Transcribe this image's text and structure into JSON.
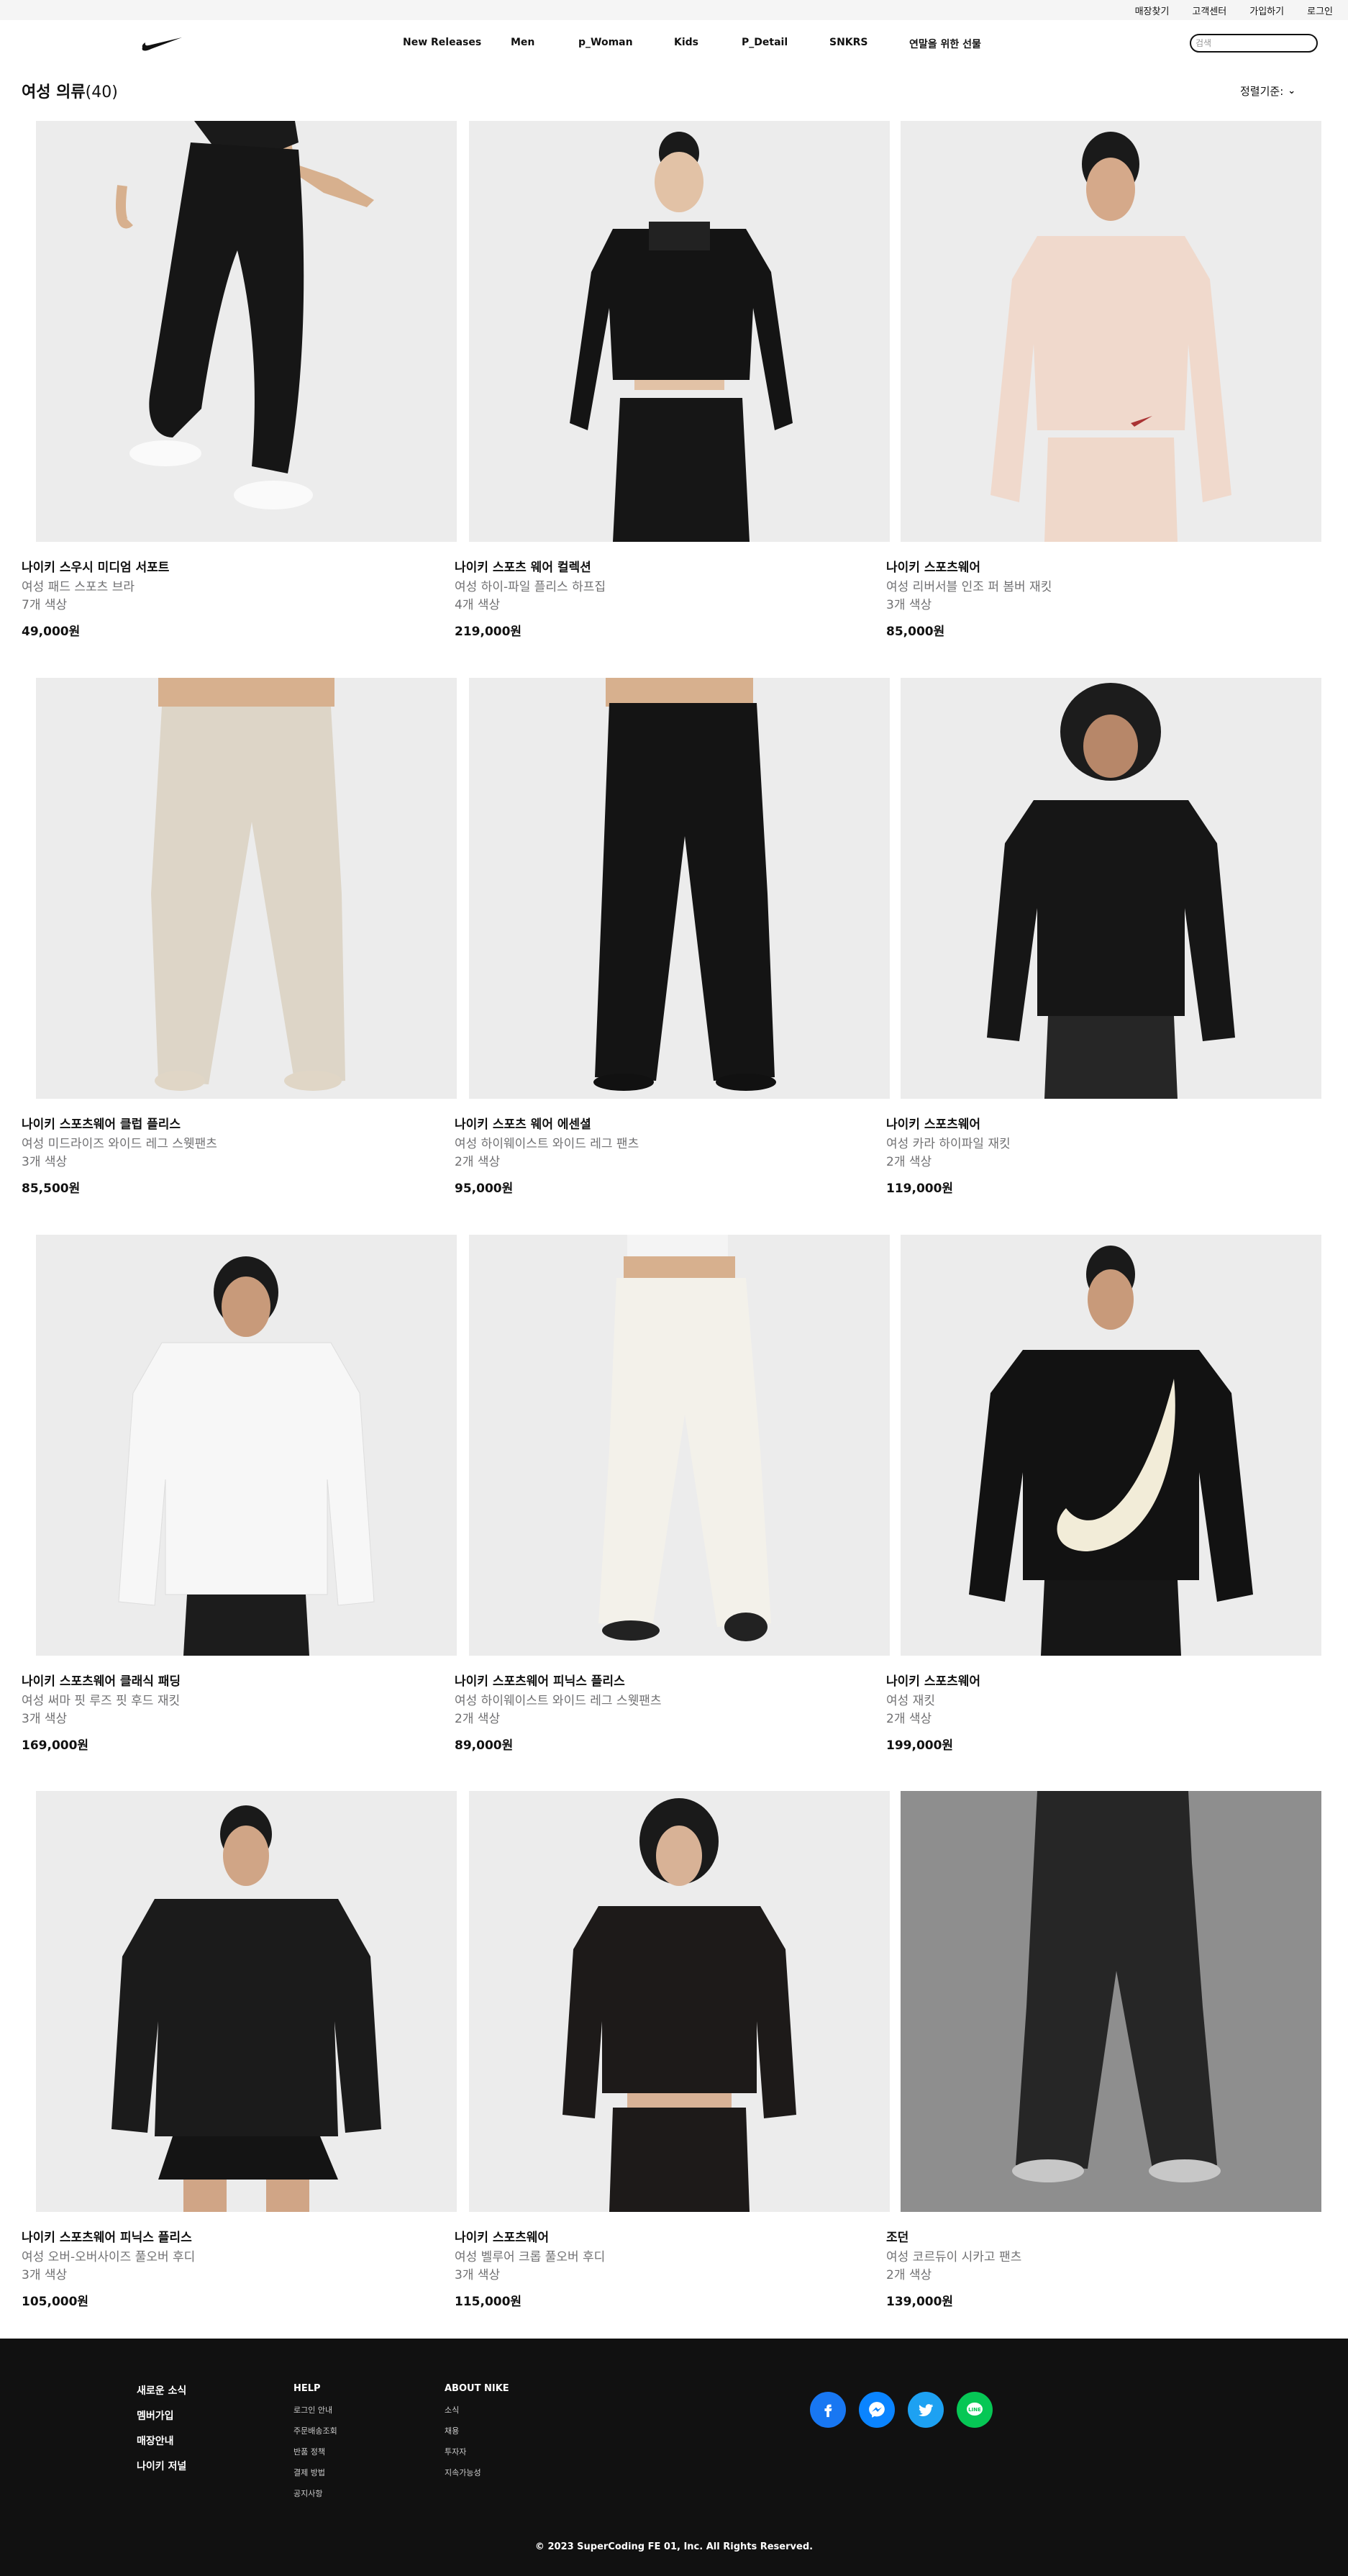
{
  "utility": [
    "매장찾기",
    "고객센터",
    "가입하기",
    "로그인"
  ],
  "nav": {
    "links": [
      "New Releases",
      "Men",
      "p_Woman",
      "Kids",
      "P_Detail",
      "SNKRS",
      "연말을 위한 선물"
    ],
    "search_placeholder": "검색"
  },
  "heading": {
    "title": "여성 의류",
    "count": "(40)"
  },
  "sort": {
    "label": "정렬기준:"
  },
  "products": [
    {
      "name": "나이키 스우시 미디엄 서포트",
      "sub": "여성 패드 스포츠 브라",
      "colors": "7개 색상",
      "price": "49,000원"
    },
    {
      "name": "나이키 스포츠 웨어 컬렉션",
      "sub": "여성 하이-파일 플리스 하프집",
      "colors": "4개 색상",
      "price": "219,000원"
    },
    {
      "name": "나이키 스포츠웨어",
      "sub": "여성 리버서블 인조 퍼 봄버 재킷",
      "colors": "3개 색상",
      "price": "85,000원"
    },
    {
      "name": "나이키 스포츠웨어 클럽 플리스",
      "sub": "여성 미드라이즈 와이드 레그 스웻팬츠",
      "colors": "3개 색상",
      "price": "85,500원"
    },
    {
      "name": "나이키 스포츠 웨어 에센셜",
      "sub": "여성 하이웨이스트 와이드 레그 팬츠",
      "colors": "2개 색상",
      "price": "95,000원"
    },
    {
      "name": "나이키 스포츠웨어",
      "sub": "여성 카라 하이파일 재킷",
      "colors": "2개 색상",
      "price": "119,000원"
    },
    {
      "name": "나이키 스포츠웨어 클래식 패딩",
      "sub": "여성 써마 핏 루즈 핏 후드 재킷",
      "colors": "3개 색상",
      "price": "169,000원"
    },
    {
      "name": "나이키 스포츠웨어 피닉스 플리스",
      "sub": "여성 하이웨이스트 와이드 레그 스웻팬츠",
      "colors": "2개 색상",
      "price": "89,000원"
    },
    {
      "name": "나이키 스포츠웨어",
      "sub": "여성 재킷",
      "colors": "2개 색상",
      "price": "199,000원"
    },
    {
      "name": "나이키 스포츠웨어 피닉스 플리스",
      "sub": "여성 오버-오버사이즈 풀오버 후디",
      "colors": "3개 색상",
      "price": "105,000원"
    },
    {
      "name": "나이키 스포츠웨어",
      "sub": "여성 벨루어 크롭 풀오버 후디",
      "colors": "3개 색상",
      "price": "115,000원"
    },
    {
      "name": "조던",
      "sub": "여성 코르듀이 시카고 팬츠",
      "colors": "2개 색상",
      "price": "139,000원"
    }
  ],
  "footer": {
    "col1": [
      "새로운 소식",
      "멤버가입",
      "매장안내",
      "나이키 저널"
    ],
    "help": {
      "title": "HELP",
      "links": [
        "로그인 안내",
        "주문배송조회",
        "반품 정책",
        "결제 방법",
        "공지사항"
      ]
    },
    "about": {
      "title": "ABOUT NIKE",
      "links": [
        "소식",
        "채용",
        "투자자",
        "지속가능성"
      ]
    },
    "socials": [
      {
        "icon": "facebook-icon",
        "color": "#1877f2"
      },
      {
        "icon": "messenger-icon",
        "color": "#0a84ff"
      },
      {
        "icon": "twitter-icon",
        "color": "#1da1f2"
      },
      {
        "icon": "line-icon",
        "color": "#06c755"
      }
    ],
    "copyright": "© 2023 SuperCoding FE 01, Inc. All Rights Reserved."
  }
}
